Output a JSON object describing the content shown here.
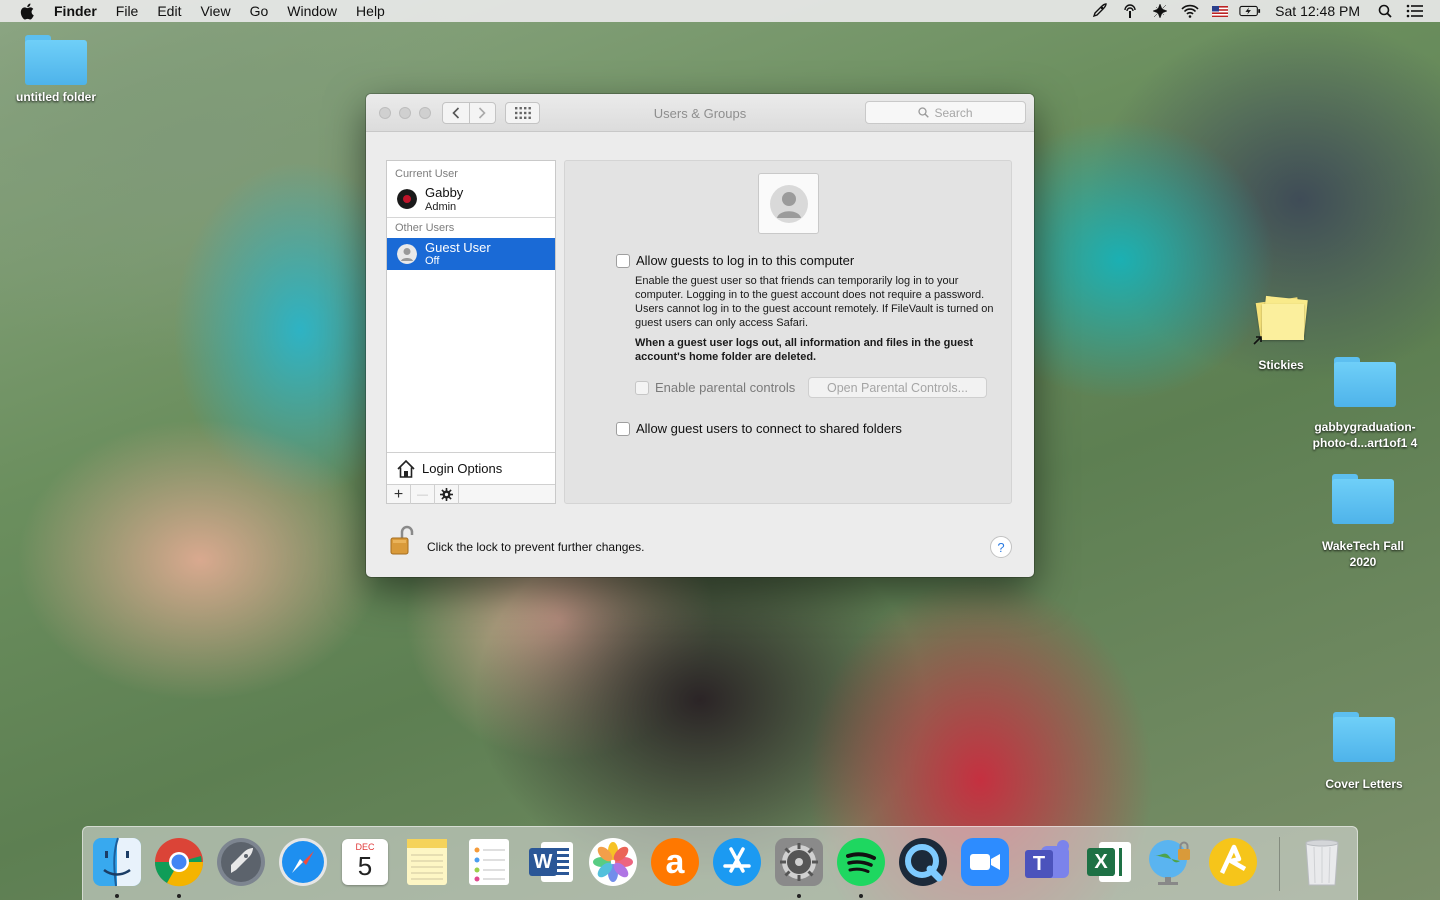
{
  "menubar": {
    "app_name": "Finder",
    "menus": [
      "File",
      "Edit",
      "View",
      "Go",
      "Window",
      "Help"
    ],
    "clock": "Sat 12:48 PM",
    "status_icons": [
      "rocket-icon",
      "airdrop-icon",
      "extension-icon",
      "wifi-icon",
      "us-flag-icon",
      "battery-charging-icon",
      "spotlight-icon",
      "notification-center-icon"
    ]
  },
  "desktop": {
    "icons": [
      {
        "label": "untitled folder",
        "type": "folder"
      },
      {
        "label": "Stickies",
        "type": "alias"
      },
      {
        "label": "gabbygraduation-photo-d...art1of1 4",
        "label_line1": "gabbygraduation-",
        "label_line2": "photo-d...art1of1 4",
        "type": "folder"
      },
      {
        "label": "WakeTech Fall 2020",
        "label_line1": "WakeTech Fall",
        "label_line2": "2020",
        "type": "folder"
      },
      {
        "label": "Cover Letters",
        "type": "folder"
      }
    ]
  },
  "window": {
    "title": "Users & Groups",
    "search_placeholder": "Search",
    "sidebar": {
      "current_user_header": "Current User",
      "current_user": {
        "name": "Gabby",
        "role": "Admin"
      },
      "other_users_header": "Other Users",
      "other_users": [
        {
          "name": "Guest User",
          "status": "Off",
          "selected": true
        }
      ],
      "login_options_label": "Login Options",
      "add_label": "+",
      "remove_label": "—"
    },
    "guest_pane": {
      "allow_login_label": "Allow guests to log in to this computer",
      "allow_login_checked": false,
      "description": "Enable the guest user so that friends can temporarily log in to your computer. Logging in to the guest account does not require a password. Users cannot log in to the guest account remotely. If FileVault is turned on guest users can only access Safari.",
      "warning": "When a guest user logs out, all information and files in the guest account's home folder are deleted.",
      "parental_controls_label": "Enable parental controls",
      "parental_controls_checked": false,
      "open_parental_controls_label": "Open Parental Controls...",
      "shared_folders_label": "Allow guest users to connect to shared folders",
      "shared_folders_checked": false
    },
    "footer": {
      "lock_text": "Click the lock to prevent further changes.",
      "help_label": "?"
    }
  },
  "dock": {
    "apps": [
      "Finder",
      "Google Chrome",
      "Launchpad",
      "Safari",
      "Calendar",
      "Notes",
      "Reminders",
      "Microsoft Word",
      "Photos",
      "Avast",
      "App Store",
      "System Preferences",
      "Spotify",
      "QuickTime Player",
      "Zoom",
      "Microsoft Teams",
      "Microsoft Excel",
      "Network Utility",
      "Instastats",
      "Trash"
    ],
    "calendar_month": "DEC",
    "calendar_day": "5",
    "word_letter": "W",
    "teams_letter": "T",
    "excel_letter": "X",
    "avast_letter": "a"
  },
  "colors": {
    "selection": "#1a6ad6",
    "folder": "#5dbff0",
    "help": "#2a7ae2"
  }
}
